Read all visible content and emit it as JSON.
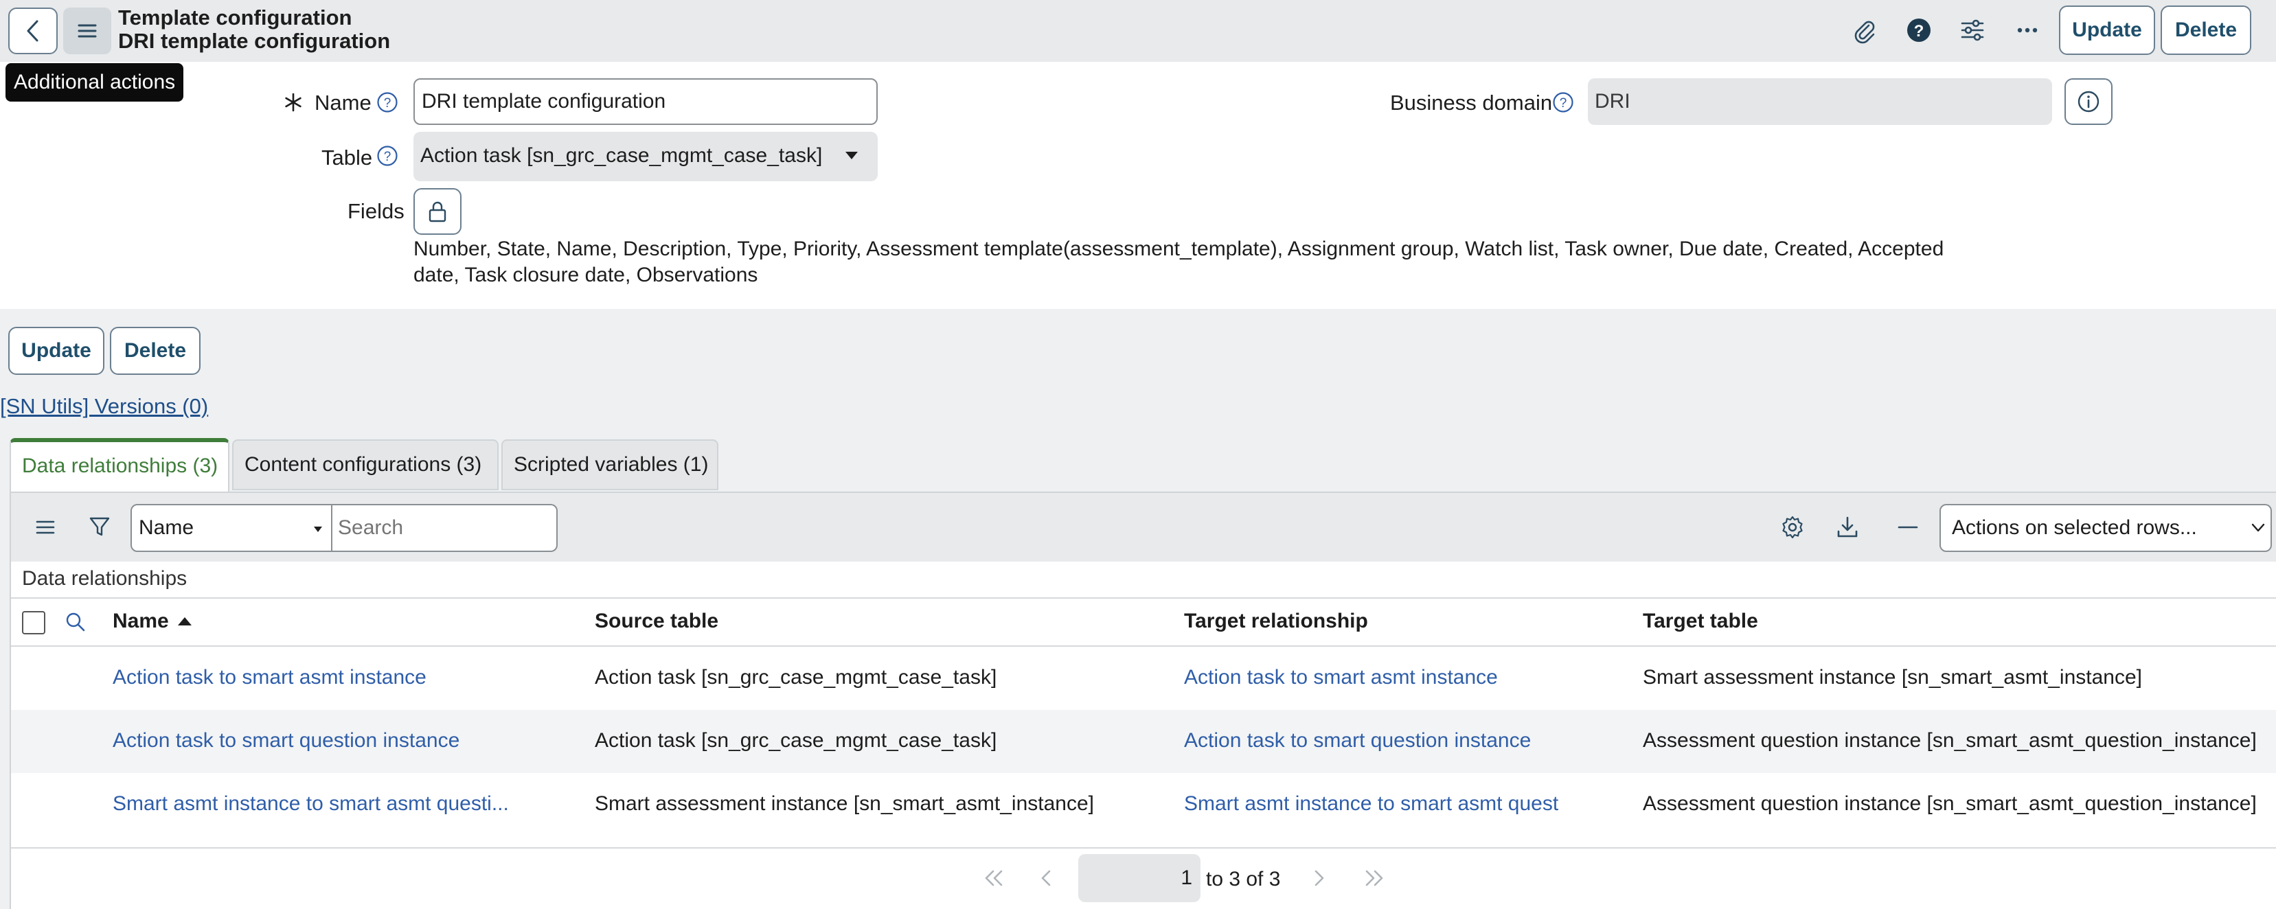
{
  "header": {
    "title_line1": "Template configuration",
    "title_line2": "DRI template configuration",
    "update_label": "Update",
    "delete_label": "Delete",
    "tooltip": "Additional actions"
  },
  "form": {
    "name_label": "Name",
    "name_value": "DRI template configuration",
    "business_domain_label": "Business domain",
    "business_domain_value": "DRI",
    "table_label": "Table",
    "table_value": "Action task [sn_grc_case_mgmt_case_task]",
    "fields_label": "Fields",
    "fields_line1": "Number, State, Name, Description, Type, Priority, Assessment template(assessment_template), Assignment group, Watch list, Task owner, Due date, Created, Accepted",
    "fields_line2": "date, Task closure date, Observations"
  },
  "bottom_buttons": {
    "update_label": "Update",
    "delete_label": "Delete"
  },
  "versions_link": "[SN Utils] Versions (0)",
  "tabs": [
    {
      "label": "Data relationships (3)"
    },
    {
      "label": "Content configurations (3)"
    },
    {
      "label": "Scripted variables (1)"
    }
  ],
  "list": {
    "search_field_option": "Name",
    "search_placeholder": "Search",
    "actions_select": "Actions on selected rows...",
    "caption": "Data relationships",
    "columns": [
      "Name",
      "Source table",
      "Target relationship",
      "Target table"
    ],
    "rows": [
      [
        "Action task to smart asmt instance",
        "Action task [sn_grc_case_mgmt_case_task]",
        "Action task to smart asmt instance",
        "Smart assessment instance [sn_smart_asmt_instance]"
      ],
      [
        "Action task to smart question instance",
        "Action task [sn_grc_case_mgmt_case_task]",
        "Action task to smart question instance",
        "Assessment question instance [sn_smart_asmt_question_instance]"
      ],
      [
        "Smart asmt instance to smart asmt questi...",
        "Smart assessment instance [sn_smart_asmt_instance]",
        "Smart asmt instance to smart asmt quest",
        "Assessment question instance [sn_smart_asmt_question_instance]"
      ]
    ],
    "pagination": {
      "current": "1",
      "of_text": "to 3 of 3"
    }
  },
  "colors": {
    "header_bg": "#e8eaec",
    "link": "#2f5ea8",
    "active_tab_accent": "#3f7d3a",
    "button_text": "#1f4f6b"
  }
}
